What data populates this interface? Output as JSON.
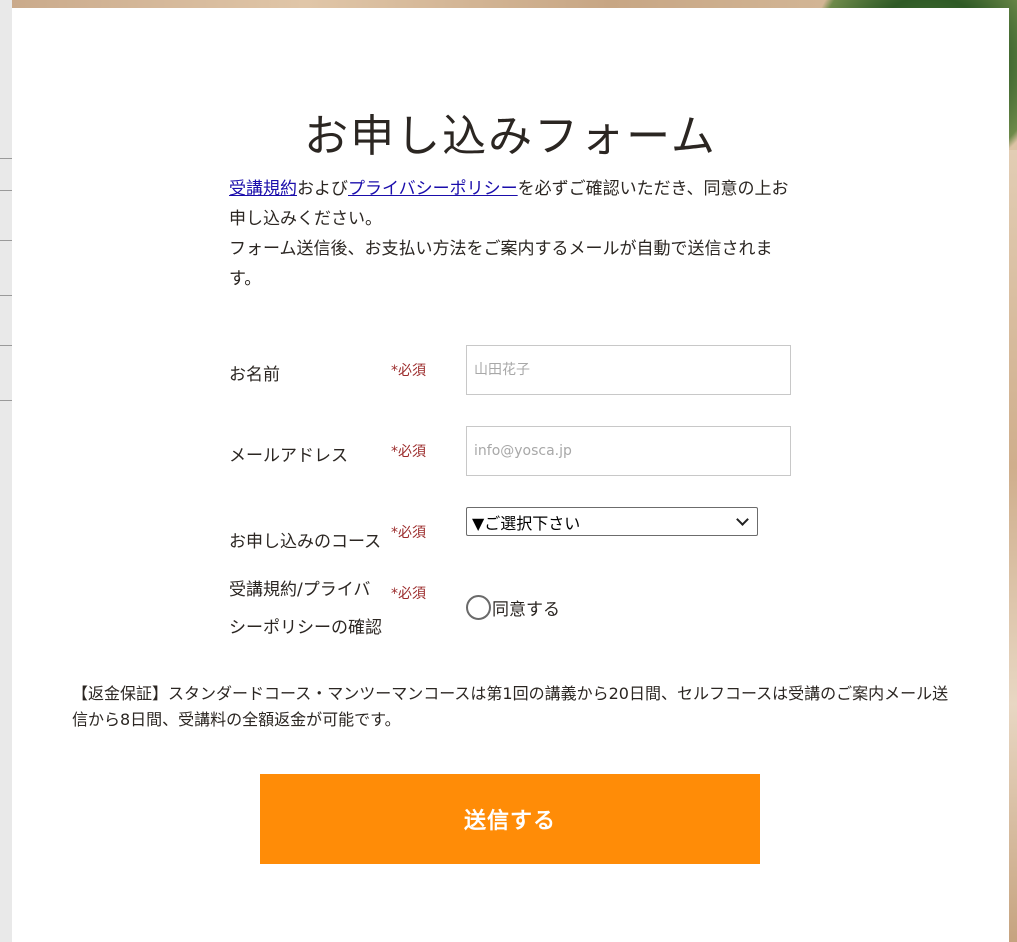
{
  "form": {
    "title": "お申し込みフォーム",
    "intro": {
      "terms_link": "受講規約",
      "and_text": "および",
      "privacy_link": "プライバシーポリシー",
      "line1_rest": "を必ずご確認いただき、同意の上お申し込みください。",
      "line2": "フォーム送信後、お支払い方法をご案内するメールが自動で送信されます。"
    },
    "required_label": "*必須",
    "fields": {
      "name_label": "お名前",
      "name_placeholder": "山田花子",
      "email_label": "メールアドレス",
      "email_placeholder": "info@yosca.jp",
      "course_label": "お申し込みのコース",
      "course_selected": "▼ご選択下さい",
      "agree_label_line1": "受講規約/プライバ",
      "agree_label_line2": "シーポリシーの確認",
      "agree_option": "同意する"
    },
    "notice": "【返金保証】スタンダードコース・マンツーマンコースは第1回の講義から20日間、セルフコースは受講のご案内メール送信から8日間、受講料の全額返金が可能です。",
    "submit_label": "送信する"
  },
  "colors": {
    "submit_bg": "#ff8c07",
    "required": "#9b2b2b",
    "link": "#1a0dab"
  }
}
